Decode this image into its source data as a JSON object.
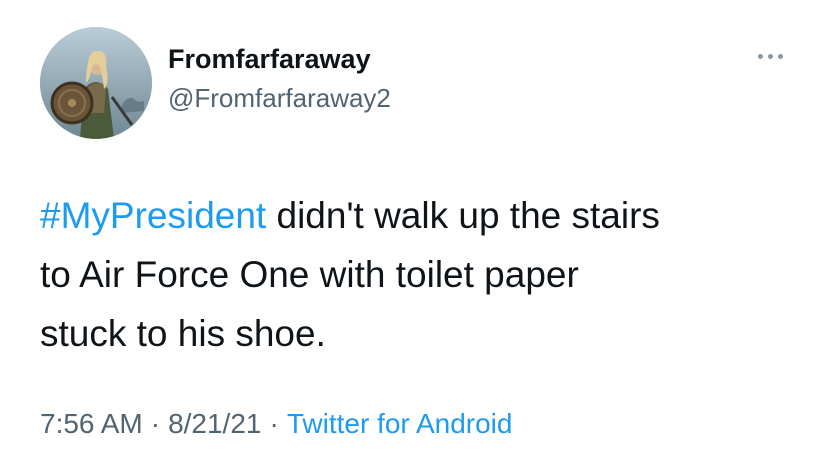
{
  "tweet": {
    "avatar_icon": "avatar-warrior-woman-with-shield",
    "display_name": "Fromfarfaraway",
    "handle": "@Fromfarfaraway2",
    "more_icon": "more-horizontal-icon",
    "text": {
      "hashtag": "#MyPresident",
      "line1_rest": " didn't walk up the stairs",
      "line2": "to Air Force One with toilet paper",
      "line3": "stuck to his shoe."
    },
    "meta": {
      "time": "7:56 AM",
      "separator": "·",
      "date": "8/21/21",
      "source": "Twitter for Android"
    }
  },
  "colors": {
    "link": "#1d9bf0",
    "secondary_text": "#536471",
    "primary_text": "#0f1419",
    "background": "#ffffff"
  }
}
